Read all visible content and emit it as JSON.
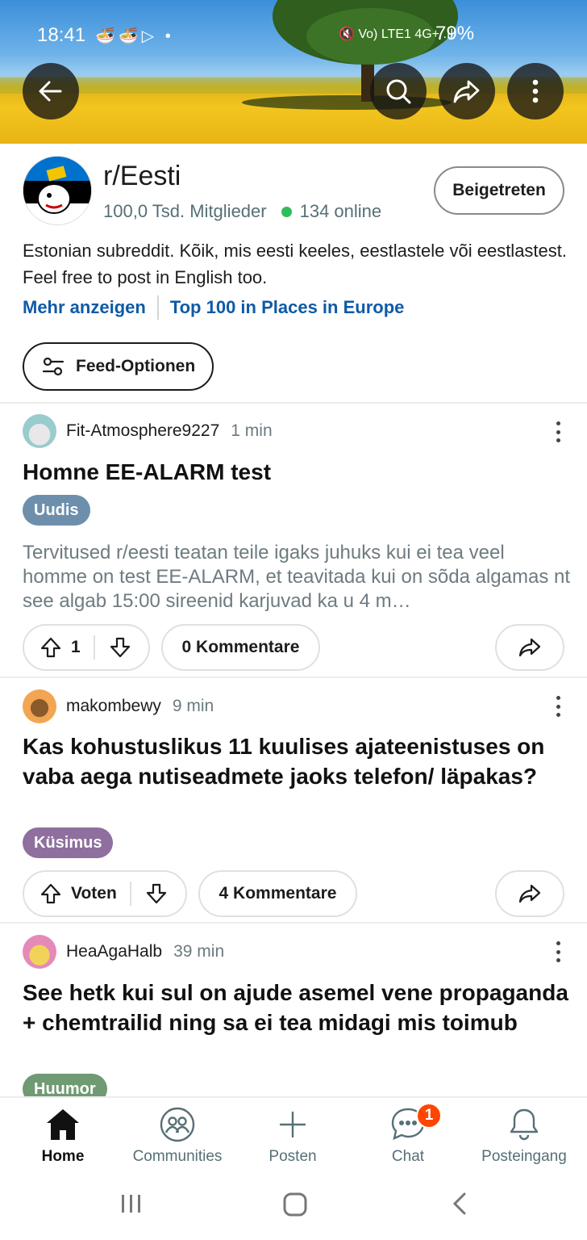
{
  "status_bar": {
    "time": "18:41",
    "left_icons": "🍜🍜▷ •",
    "right_icons": "🔇 Vo) LTE1 4G+ .ıl",
    "battery": "79%"
  },
  "top_actions": {
    "back_icon": "arrow-left-icon",
    "search_icon": "search-icon",
    "share_icon": "share-icon",
    "more_icon": "more-vertical-icon"
  },
  "subreddit": {
    "name": "r/Eesti",
    "members": "100,0 Tsd. Mitglieder",
    "online": "134 online",
    "joined_label": "Beigetreten",
    "description": "Estonian subreddit. Kõik, mis eesti keeles, eestlastele või eestlastest. Feel free to post in English too.",
    "show_more": "Mehr anzeigen",
    "ranking": "Top 100 in Places in Europe",
    "feed_options": "Feed-Optionen"
  },
  "posts": [
    {
      "author": "Fit-Atmosphere9227",
      "age": "1 min",
      "title": "Homne EE-ALARM test",
      "flair": "Uudis",
      "flair_color": "#6d8fab",
      "body": "Tervitused r/eesti teatan teile igaks juhuks  kui ei tea veel homme on test EE-ALARM, et teavitada kui on sõda algamas nt see algab 15:00 sireenid karjuvad ka u 4 m…",
      "votes": "1",
      "comments": "0 Kommentare"
    },
    {
      "author": "makombewy",
      "age": "9 min",
      "title": "Kas kohustuslikus 11 kuulises ajateenistuses on vaba aega nutiseadmete jaoks telefon/ läpakas?",
      "flair": "Küsimus",
      "flair_color": "#8e6f9e",
      "votes": "Voten",
      "comments": "4 Kommentare"
    },
    {
      "author": "HeaAgaHalb",
      "age": "39 min",
      "title": "See hetk kui sul on ajude asemel vene propaganda + chemtrailid ning sa ei tea midagi mis toimub",
      "flair": "Huumor",
      "flair_color": "#6f9a73"
    }
  ],
  "bottom_nav": {
    "home": "Home",
    "communities": "Communities",
    "post": "Posten",
    "chat": "Chat",
    "chat_badge": "1",
    "inbox": "Posteingang"
  },
  "colors": {
    "link": "#0f5aa7",
    "online_dot": "#2ebd59",
    "badge": "#ff4500"
  }
}
